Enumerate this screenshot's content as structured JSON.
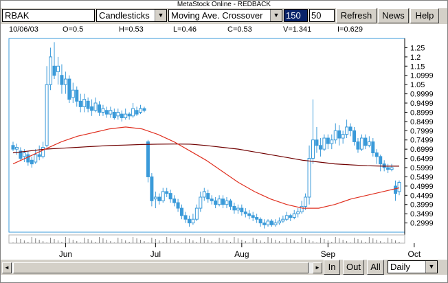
{
  "window": {
    "title": "MetaStock Online - REDBACK"
  },
  "toolbar": {
    "symbol": "RBAK",
    "chart_type": "Candlesticks",
    "indicator": "Moving Ave. Crossover",
    "param1": "150",
    "param2": "50",
    "refresh_label": "Refresh",
    "news_label": "News",
    "help_label": "Help",
    "dropdown_arrow": "▼"
  },
  "info": {
    "date": "10/06/03",
    "open": "O=0.5",
    "high": "H=0.53",
    "low": "L=0.46",
    "close": "C=0.53",
    "volume": "V=1.341",
    "interest": "I=0.629"
  },
  "bottom": {
    "left_arrow": "◄",
    "right_arrow": "►",
    "in_label": "In",
    "out_label": "Out",
    "all_label": "All",
    "period": "Daily"
  },
  "colors": {
    "candle": "#3a9ad9",
    "ma_fast": "#e03020",
    "ma_slow": "#700000",
    "plot_border": "#3a9ad9"
  },
  "chart_data": {
    "type": "candlestick",
    "y_ticks": [
      "1.25",
      "1.2",
      "1.15",
      "1.0999",
      "1.05",
      "0.9999",
      "0.9499",
      "0.8999",
      "0.8499",
      "0.7999",
      "0.7499",
      "0.6999",
      "0.6499",
      "0.5999",
      "0.5499",
      "0.4999",
      "0.4499",
      "0.3999",
      "0.3499",
      "0.2999"
    ],
    "ylim": [
      0.25,
      1.3
    ],
    "x_labels": [
      {
        "label": "Jun",
        "index": 14
      },
      {
        "label": "Jul",
        "index": 38
      },
      {
        "label": "Aug",
        "index": 61
      },
      {
        "label": "Sep",
        "index": 84
      },
      {
        "label": "Oct",
        "index": 107
      }
    ],
    "candles": [
      [
        0.72,
        0.7,
        0.74,
        0.69
      ],
      [
        0.7,
        0.71,
        0.73,
        0.67
      ],
      [
        0.69,
        0.65,
        0.71,
        0.64
      ],
      [
        0.66,
        0.68,
        0.7,
        0.63
      ],
      [
        0.67,
        0.63,
        0.69,
        0.61
      ],
      [
        0.64,
        0.62,
        0.66,
        0.6
      ],
      [
        0.63,
        0.67,
        0.7,
        0.62
      ],
      [
        0.67,
        0.66,
        0.72,
        0.64
      ],
      [
        0.66,
        0.71,
        0.74,
        0.65
      ],
      [
        0.72,
        1.05,
        1.15,
        0.71
      ],
      [
        1.05,
        1.2,
        1.25,
        1.02
      ],
      [
        1.15,
        1.1,
        1.28,
        1.08
      ],
      [
        1.12,
        1.15,
        1.2,
        1.05
      ],
      [
        1.1,
        1.05,
        1.16,
        1.0
      ],
      [
        1.05,
        1.08,
        1.12,
        1.0
      ],
      [
        1.08,
        0.97,
        1.1,
        0.95
      ],
      [
        0.98,
        1.02,
        1.06,
        0.95
      ],
      [
        1.02,
        0.96,
        1.04,
        0.93
      ],
      [
        0.96,
        0.93,
        1.0,
        0.9
      ],
      [
        0.93,
        0.97,
        1.0,
        0.9
      ],
      [
        0.96,
        0.92,
        0.98,
        0.9
      ],
      [
        0.93,
        0.91,
        0.97,
        0.88
      ],
      [
        0.91,
        0.95,
        0.98,
        0.9
      ],
      [
        0.94,
        0.9,
        0.96,
        0.88
      ],
      [
        0.9,
        0.92,
        0.94,
        0.88
      ],
      [
        0.91,
        0.89,
        0.93,
        0.87
      ],
      [
        0.89,
        0.91,
        0.93,
        0.87
      ],
      [
        0.9,
        0.87,
        0.92,
        0.86
      ],
      [
        0.88,
        0.9,
        0.92,
        0.86
      ],
      [
        0.89,
        0.87,
        0.91,
        0.85
      ],
      [
        0.87,
        0.89,
        0.92,
        0.86
      ],
      [
        0.89,
        0.88,
        0.9,
        0.86
      ],
      [
        0.88,
        0.92,
        0.95,
        0.87
      ],
      [
        0.91,
        0.89,
        0.93,
        0.88
      ],
      [
        0.9,
        0.92,
        0.94,
        0.89
      ],
      [
        0.92,
        0.91,
        0.93,
        0.9
      ],
      [
        0.74,
        0.55,
        0.75,
        0.52
      ],
      [
        0.55,
        0.42,
        0.57,
        0.39
      ],
      [
        0.43,
        0.44,
        0.47,
        0.38
      ],
      [
        0.44,
        0.42,
        0.46,
        0.4
      ],
      [
        0.42,
        0.47,
        0.49,
        0.41
      ],
      [
        0.47,
        0.46,
        0.49,
        0.44
      ],
      [
        0.46,
        0.43,
        0.48,
        0.41
      ],
      [
        0.43,
        0.41,
        0.45,
        0.39
      ],
      [
        0.41,
        0.38,
        0.43,
        0.36
      ],
      [
        0.38,
        0.34,
        0.4,
        0.32
      ],
      [
        0.34,
        0.32,
        0.36,
        0.3
      ],
      [
        0.32,
        0.3,
        0.34,
        0.28
      ],
      [
        0.3,
        0.32,
        0.35,
        0.29
      ],
      [
        0.32,
        0.38,
        0.4,
        0.31
      ],
      [
        0.38,
        0.44,
        0.47,
        0.36
      ],
      [
        0.44,
        0.47,
        0.49,
        0.42
      ],
      [
        0.46,
        0.43,
        0.48,
        0.41
      ],
      [
        0.43,
        0.42,
        0.45,
        0.4
      ],
      [
        0.42,
        0.4,
        0.44,
        0.38
      ],
      [
        0.4,
        0.43,
        0.45,
        0.39
      ],
      [
        0.43,
        0.4,
        0.45,
        0.38
      ],
      [
        0.4,
        0.42,
        0.44,
        0.38
      ],
      [
        0.42,
        0.39,
        0.43,
        0.37
      ],
      [
        0.39,
        0.37,
        0.41,
        0.35
      ],
      [
        0.37,
        0.38,
        0.4,
        0.35
      ],
      [
        0.38,
        0.36,
        0.4,
        0.34
      ],
      [
        0.36,
        0.35,
        0.38,
        0.33
      ],
      [
        0.35,
        0.34,
        0.37,
        0.32
      ],
      [
        0.34,
        0.33,
        0.36,
        0.31
      ],
      [
        0.33,
        0.32,
        0.35,
        0.3
      ],
      [
        0.32,
        0.3,
        0.33,
        0.28
      ],
      [
        0.3,
        0.29,
        0.32,
        0.27
      ],
      [
        0.29,
        0.31,
        0.32,
        0.28
      ],
      [
        0.31,
        0.29,
        0.32,
        0.28
      ],
      [
        0.29,
        0.3,
        0.32,
        0.28
      ],
      [
        0.3,
        0.31,
        0.33,
        0.29
      ],
      [
        0.31,
        0.32,
        0.34,
        0.3
      ],
      [
        0.32,
        0.34,
        0.36,
        0.31
      ],
      [
        0.34,
        0.33,
        0.35,
        0.31
      ],
      [
        0.33,
        0.35,
        0.37,
        0.32
      ],
      [
        0.35,
        0.36,
        0.38,
        0.33
      ],
      [
        0.36,
        0.39,
        0.42,
        0.35
      ],
      [
        0.39,
        0.44,
        0.46,
        0.37
      ],
      [
        0.44,
        0.65,
        0.72,
        0.4
      ],
      [
        0.65,
        0.75,
        0.97,
        0.62
      ],
      [
        0.75,
        0.72,
        0.82,
        0.68
      ],
      [
        0.72,
        0.7,
        0.76,
        0.66
      ],
      [
        0.7,
        0.76,
        0.78,
        0.69
      ],
      [
        0.76,
        0.73,
        0.78,
        0.7
      ],
      [
        0.73,
        0.75,
        0.78,
        0.7
      ],
      [
        0.75,
        0.8,
        0.84,
        0.73
      ],
      [
        0.8,
        0.76,
        0.83,
        0.72
      ],
      [
        0.76,
        0.78,
        0.8,
        0.73
      ],
      [
        0.78,
        0.82,
        0.86,
        0.76
      ],
      [
        0.82,
        0.8,
        0.84,
        0.77
      ],
      [
        0.8,
        0.74,
        0.82,
        0.72
      ],
      [
        0.74,
        0.7,
        0.76,
        0.68
      ],
      [
        0.7,
        0.76,
        0.78,
        0.69
      ],
      [
        0.76,
        0.72,
        0.78,
        0.7
      ],
      [
        0.72,
        0.74,
        0.77,
        0.71
      ],
      [
        0.74,
        0.68,
        0.76,
        0.66
      ],
      [
        0.68,
        0.66,
        0.7,
        0.62
      ],
      [
        0.66,
        0.62,
        0.67,
        0.58
      ],
      [
        0.62,
        0.6,
        0.64,
        0.58
      ],
      [
        0.6,
        0.59,
        0.62,
        0.57
      ],
      [
        0.59,
        0.6,
        0.62,
        0.58
      ],
      [
        0.5,
        0.46,
        0.53,
        0.42
      ],
      [
        0.47,
        0.52,
        0.53,
        0.45
      ]
    ],
    "ma150": [
      0.68,
      0.69,
      0.7,
      0.705,
      0.71,
      0.715,
      0.72,
      0.722,
      0.725,
      0.727,
      0.728,
      0.727,
      0.72,
      0.71,
      0.7,
      0.685,
      0.67,
      0.655,
      0.64,
      0.63,
      0.62,
      0.615,
      0.61,
      0.608,
      0.608
    ],
    "ma50": [
      0.62,
      0.66,
      0.7,
      0.74,
      0.77,
      0.79,
      0.81,
      0.82,
      0.81,
      0.78,
      0.74,
      0.69,
      0.64,
      0.58,
      0.52,
      0.47,
      0.43,
      0.4,
      0.38,
      0.38,
      0.4,
      0.43,
      0.45,
      0.47,
      0.49
    ]
  }
}
